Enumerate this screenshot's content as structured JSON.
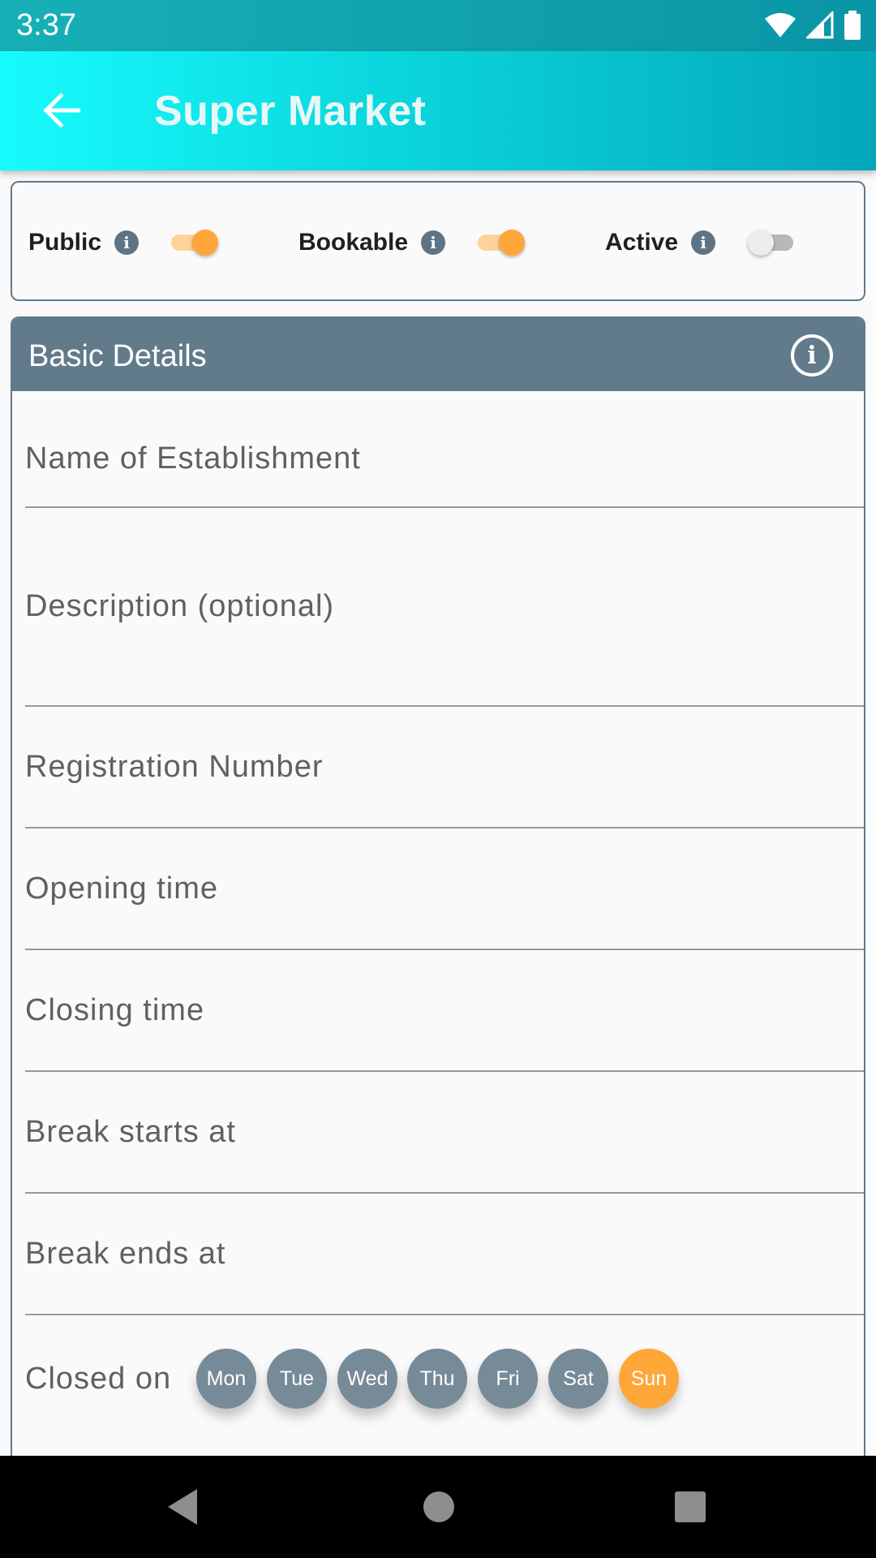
{
  "status_bar": {
    "time": "3:37"
  },
  "app_bar": {
    "title": "Super Market",
    "back_icon": "arrow-left-icon"
  },
  "toggles": [
    {
      "label": "Public",
      "on": true
    },
    {
      "label": "Bookable",
      "on": true
    },
    {
      "label": "Active",
      "on": false
    }
  ],
  "info_glyph": "i",
  "basic_details": {
    "title": "Basic Details",
    "info_icon": "info-circle-icon",
    "fields": [
      {
        "label": "Name of Establishment"
      },
      {
        "label": "Description (optional)"
      },
      {
        "label": "Registration Number"
      },
      {
        "label": "Opening time"
      },
      {
        "label": "Closing time"
      },
      {
        "label": "Break starts at"
      },
      {
        "label": "Break ends at"
      }
    ],
    "closed_on": {
      "label": "Closed on",
      "days": [
        {
          "label": "Mon",
          "selected": false
        },
        {
          "label": "Tue",
          "selected": false
        },
        {
          "label": "Wed",
          "selected": false
        },
        {
          "label": "Thu",
          "selected": false
        },
        {
          "label": "Fri",
          "selected": false
        },
        {
          "label": "Sat",
          "selected": false
        },
        {
          "label": "Sun",
          "selected": true
        }
      ]
    }
  },
  "colors": {
    "accent": "#ffa638",
    "header": "#627b8b",
    "day_chip": "#778a98"
  }
}
